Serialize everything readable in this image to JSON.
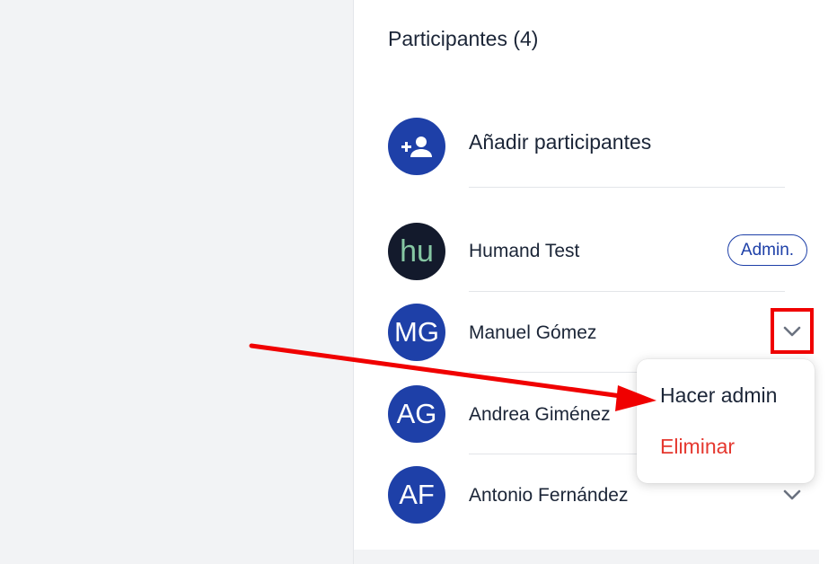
{
  "panel": {
    "title": "Participantes (4)"
  },
  "add_participants": {
    "label": "Añadir participantes",
    "icon": "add-person-icon"
  },
  "participants": [
    {
      "initials": "hu",
      "name": "Humand Test",
      "badge": "Admin.",
      "avatar_color": "#131a2c"
    },
    {
      "initials": "MG",
      "name": "Manuel Gómez",
      "avatar_color": "#1e40a8"
    },
    {
      "initials": "AG",
      "name": "Andrea Giménez",
      "avatar_color": "#1e40a8"
    },
    {
      "initials": "AF",
      "name": "Antonio Fernández",
      "avatar_color": "#1e40a8"
    }
  ],
  "dropdown": {
    "items": [
      "Hacer admin",
      "Eliminar"
    ]
  },
  "colors": {
    "accent": "#1e40a8",
    "danger": "#e5382f",
    "annotation": "#f00000"
  }
}
